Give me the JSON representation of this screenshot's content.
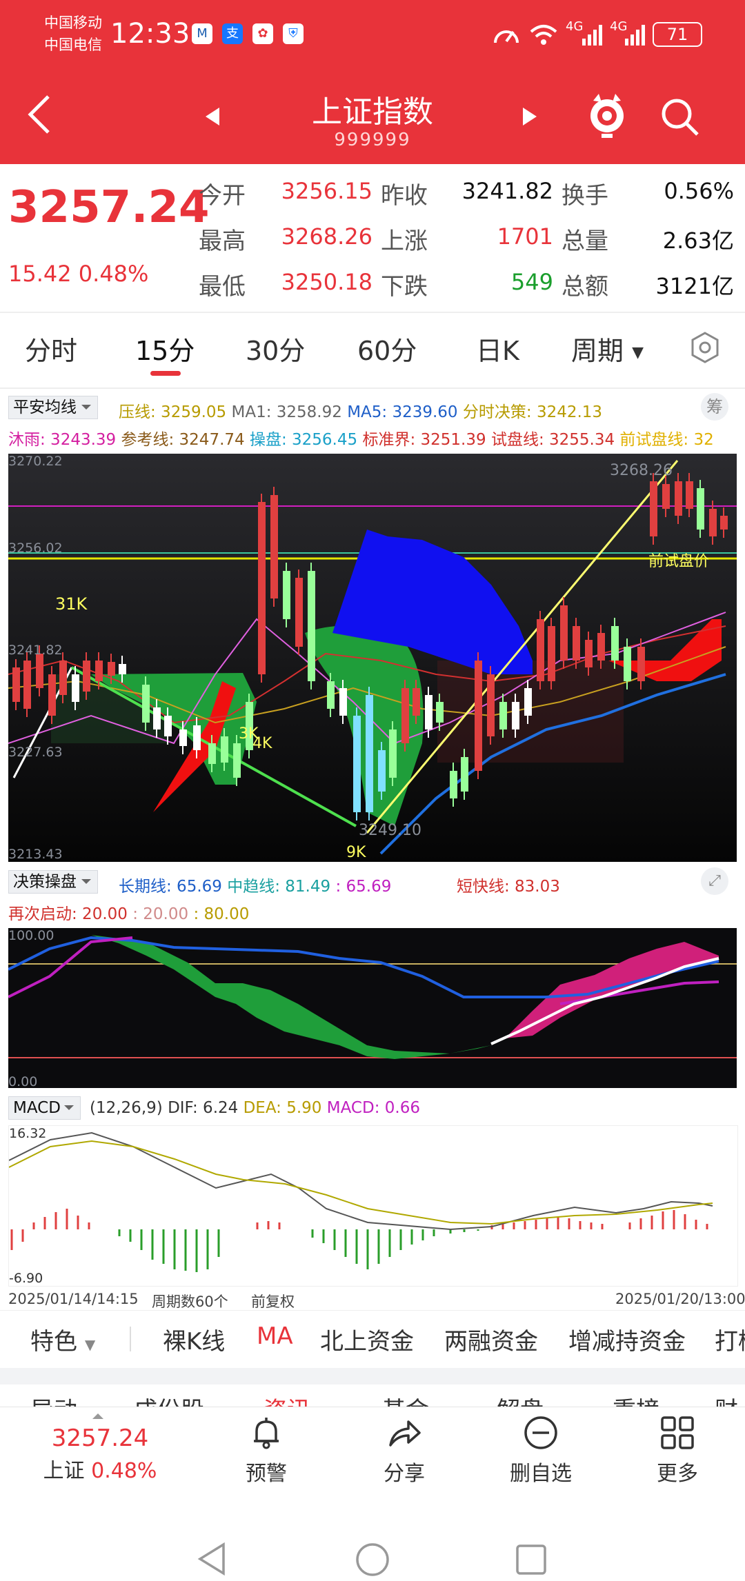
{
  "status": {
    "carrier1": "中国移动",
    "carrier2": "中国电信",
    "time": "12:33",
    "network1": "4G",
    "network2": "4G",
    "battery": "71"
  },
  "header": {
    "title": "上证指数",
    "code": "999999"
  },
  "quote": {
    "price": "3257.24",
    "change": "15.42",
    "change_pct": "0.48%",
    "open_label": "今开",
    "open": "3256.15",
    "prev_label": "昨收",
    "prev": "3241.82",
    "turnover_label": "换手",
    "turnover": "0.56%",
    "high_label": "最高",
    "high": "3268.26",
    "up_label": "上涨",
    "up": "1701",
    "volume_label": "总量",
    "volume": "2.63亿",
    "low_label": "最低",
    "low": "3250.18",
    "down_label": "下跌",
    "down": "549",
    "amount_label": "总额",
    "amount": "3121亿"
  },
  "period_tabs": [
    "分时",
    "15分",
    "30分",
    "60分",
    "日K",
    "周期"
  ],
  "active_period": "15分",
  "main_indicator": {
    "selector": "平安均线",
    "row1": [
      {
        "t": "压线: 3259.05",
        "c": "#b79b00"
      },
      {
        "t": "MA1: 3258.92",
        "c": "#666666"
      },
      {
        "t": "MA5: 3239.60",
        "c": "#1f5fc8"
      },
      {
        "t": "分时决策: 3242.13",
        "c": "#b79b00"
      }
    ],
    "row2": [
      {
        "t": "沐雨: 3243.39",
        "c": "#d41fa0"
      },
      {
        "t": "参考线: 3247.74",
        "c": "#8a5a1a"
      },
      {
        "t": "操盘: 3256.45",
        "c": "#1aa0c8"
      },
      {
        "t": "标准界: 3251.39",
        "c": "#d0312d"
      },
      {
        "t": "试盘线: 3255.34",
        "c": "#d0312d"
      },
      {
        "t": "前试盘线: 32",
        "c": "#e0b000"
      }
    ],
    "chip_button": "筹"
  },
  "main_chart": {
    "y_ticks": [
      "3270.22",
      "3256.02",
      "3241.82",
      "3227.63",
      "3213.43"
    ],
    "annotations": [
      "31K",
      "3K",
      "4K",
      "9K",
      "3268.26",
      "3249.10",
      "前试盘价"
    ]
  },
  "sub1": {
    "selector": "决策操盘",
    "row1": [
      {
        "t": "长期线: 65.69",
        "c": "#1f5fc8"
      },
      {
        "t": "中趋线: 81.49",
        "c": "#1aa0a0"
      },
      {
        "t": ": 65.69",
        "c": "#c020c0"
      },
      {
        "t": "短快线: 83.03",
        "c": "#d0312d"
      }
    ],
    "row2": [
      {
        "t": "再次启动: 20.00",
        "c": "#d0312d"
      },
      {
        "t": ": 20.00",
        "c": "#d08a8a"
      },
      {
        "t": ": 80.00",
        "c": "#b79b00"
      }
    ],
    "y_top": "100.00",
    "y_bottom": "0.00"
  },
  "macd": {
    "selector": "MACD",
    "params": "(12,26,9)",
    "dif": "DIF: 6.24",
    "dea": "DEA: 5.90",
    "macd": "MACD: 0.66",
    "y_top": "16.32",
    "y_bottom": "-6.90"
  },
  "footer_axis": {
    "start": "2025/01/14/14:15",
    "count": "周期数60个",
    "adjust": "前复权",
    "end": "2025/01/20/13:00"
  },
  "bottom_tabs": [
    "特色",
    "裸K线",
    "MA",
    "北上资金",
    "两融资金",
    "增减持资金",
    "打榜"
  ],
  "active_bottom_tab": "MA",
  "news_tabs": [
    "异动",
    "成份股",
    "资讯",
    "基金",
    "解盘",
    "重榜",
    "财"
  ],
  "bottom_nav": {
    "price": "3257.24",
    "index_name": "上证",
    "index_pct": "0.48%",
    "items": [
      "预警",
      "分享",
      "删自选",
      "更多"
    ]
  },
  "colors": {
    "accent": "#e8333a",
    "up": "#e8333a",
    "down": "#1a9e2c"
  }
}
